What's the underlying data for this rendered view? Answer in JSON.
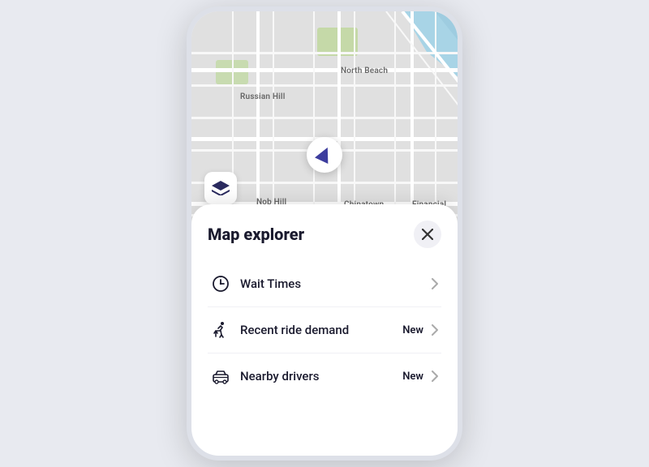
{
  "phone": {
    "map": {
      "labels": [
        "North Beach",
        "Russian Hill",
        "Nob Hill",
        "Chinatown",
        "Financial"
      ]
    },
    "sheet": {
      "title": "Map explorer",
      "close_label": "×",
      "items": [
        {
          "id": "wait-times",
          "label": "Wait Times",
          "badge": null
        },
        {
          "id": "recent-ride-demand",
          "label": "Recent ride demand",
          "badge": "New"
        },
        {
          "id": "nearby-drivers",
          "label": "Nearby drivers",
          "badge": "New"
        }
      ]
    }
  }
}
